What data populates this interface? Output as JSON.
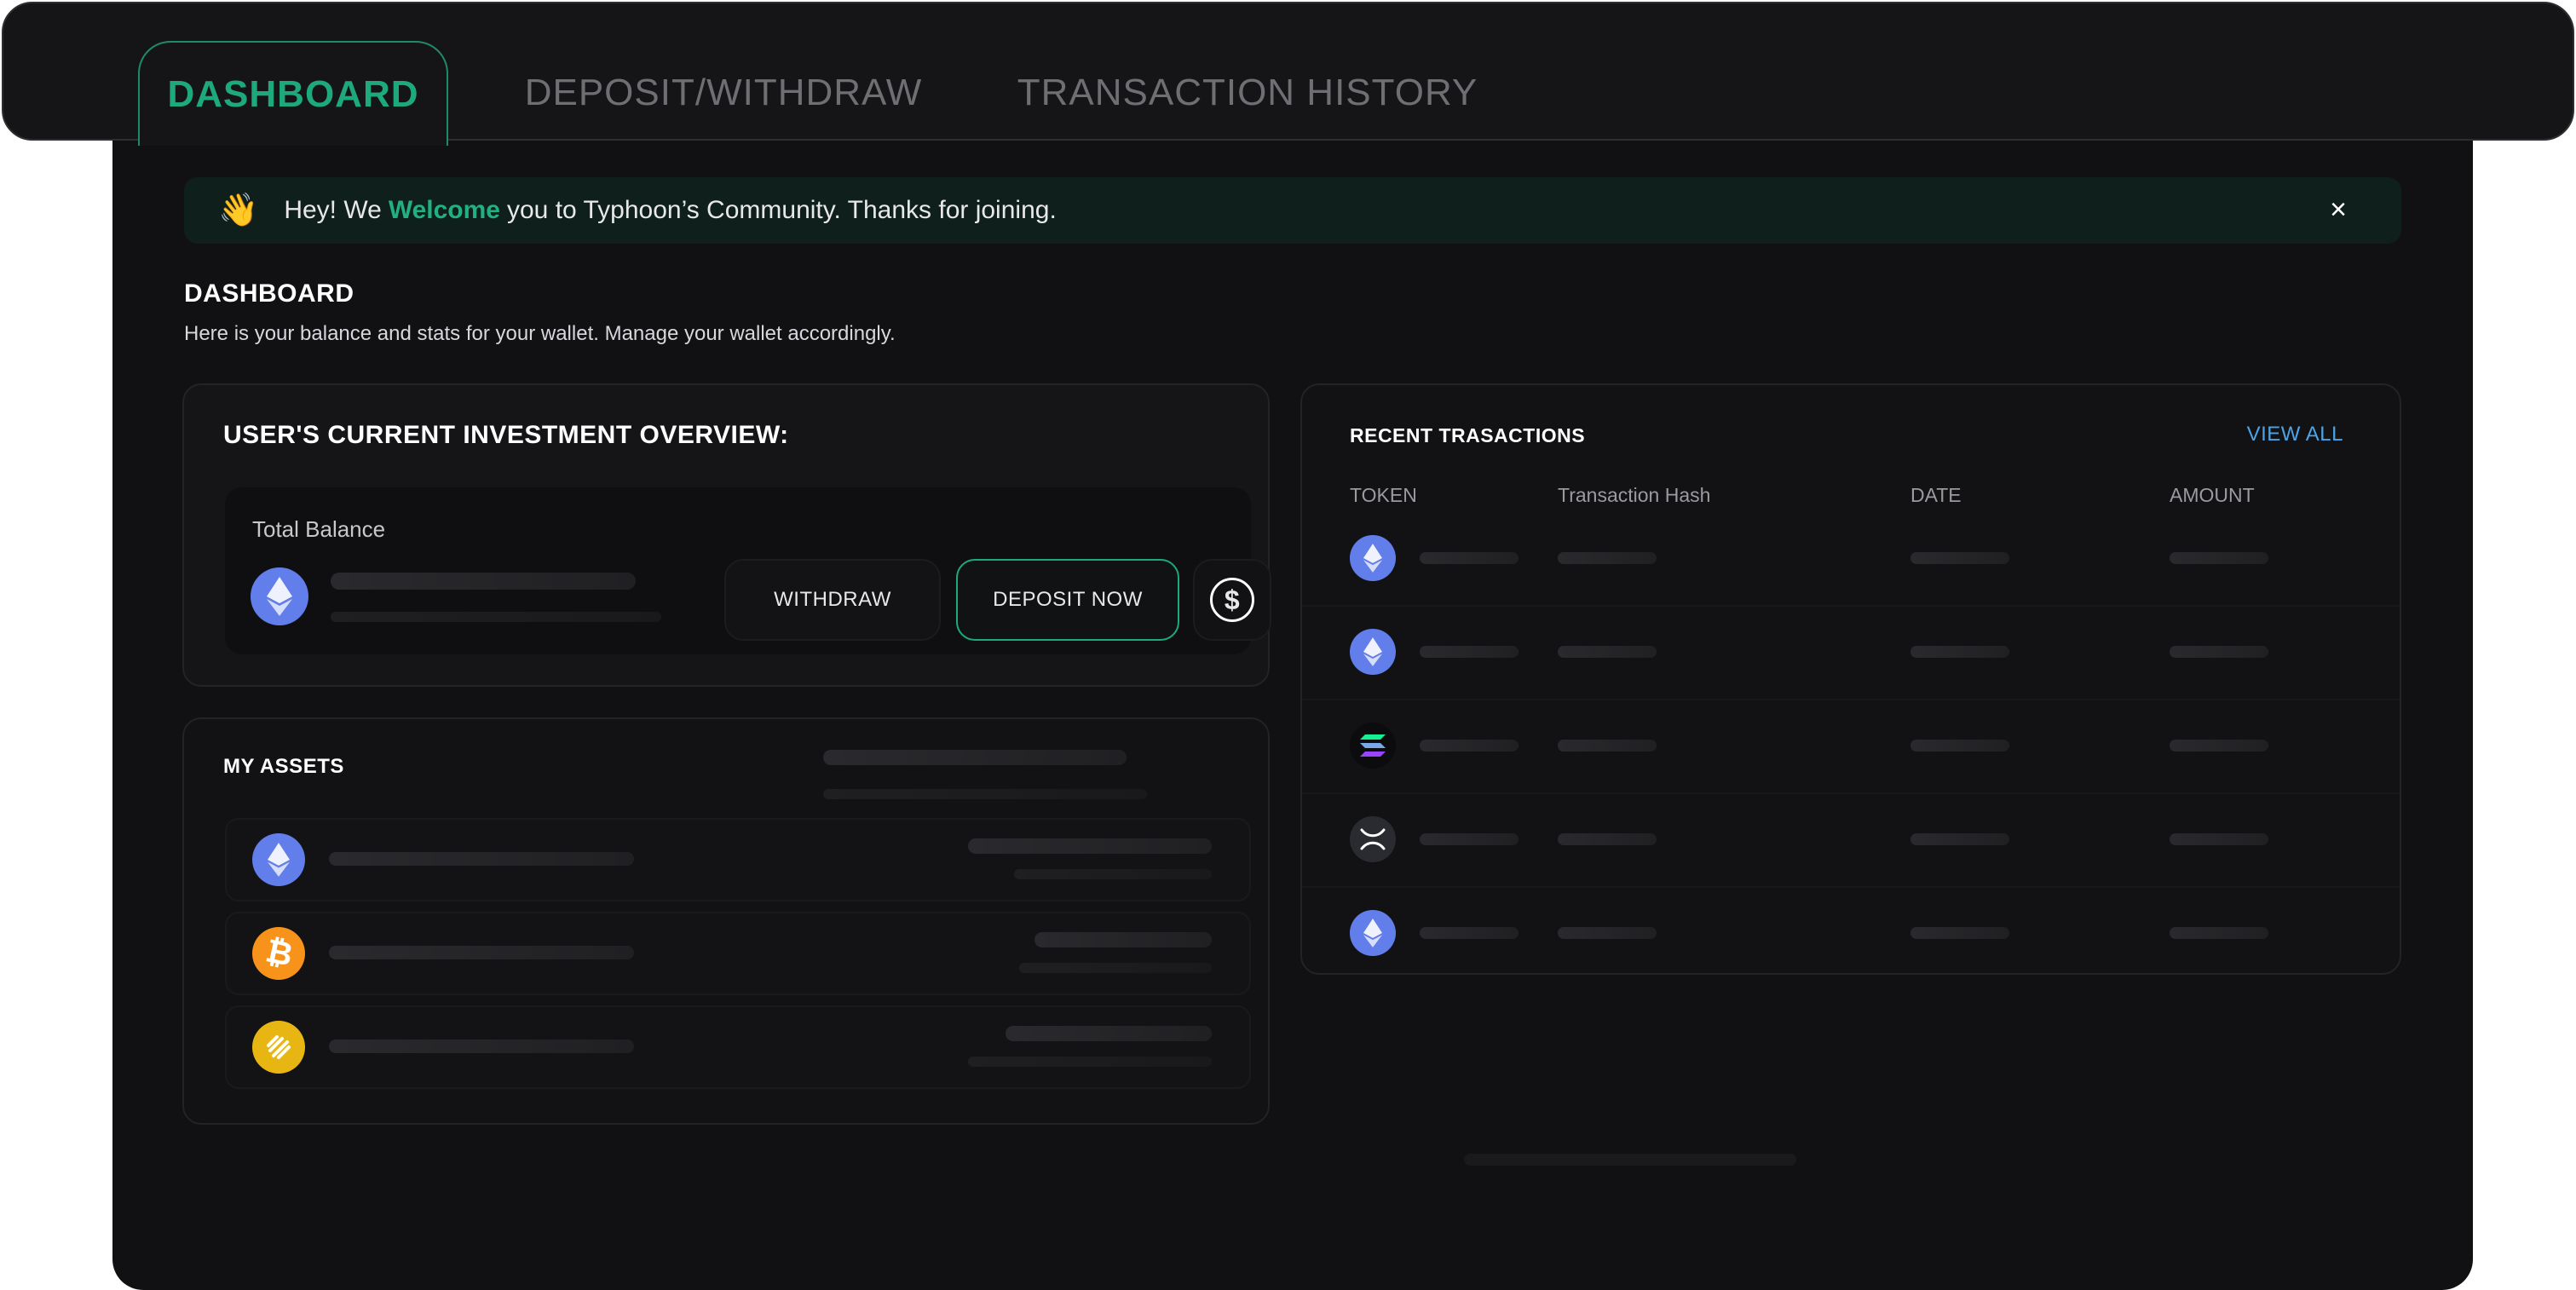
{
  "tabs": [
    {
      "label": "DASHBOARD",
      "active": true
    },
    {
      "label": "DEPOSIT/WITHDRAW",
      "active": false
    },
    {
      "label": "TRANSACTION HISTORY",
      "active": false
    }
  ],
  "banner": {
    "emoji": "👋",
    "prefix": "Hey! We",
    "highlight": "Welcome",
    "suffix": "you to Typhoon’s Community. Thanks for joining.",
    "close": "×",
    "highlight_color": "#21b07f"
  },
  "page": {
    "title": "DASHBOARD",
    "subtitle": "Here is your balance and stats for your wallet. Manage your wallet accordingly."
  },
  "overview": {
    "title": "USER'S CURRENT INVESTMENT OVERVIEW:",
    "balance_label": "Total Balance",
    "token_icon": "ethereum-icon",
    "withdraw_label": "WITHDRAW",
    "deposit_label": "DEPOSIT NOW",
    "deposit_border_color": "#1ea97c",
    "dollar_icon": "$"
  },
  "assets": {
    "title": "MY ASSETS",
    "items": [
      {
        "icon": "ethereum-icon",
        "color": "#627eea"
      },
      {
        "icon": "bitcoin-icon",
        "color": "#f7931a"
      },
      {
        "icon": "binance-usd-icon",
        "color": "#e8b613"
      }
    ]
  },
  "recent": {
    "title": "RECENT TRASACTIONS",
    "view_all": "VIEW ALL",
    "view_all_color": "#4ca3e6",
    "columns": [
      "TOKEN",
      "Transaction Hash",
      "DATE",
      "AMOUNT"
    ],
    "rows": [
      {
        "icon": "ethereum-icon"
      },
      {
        "icon": "ethereum-icon"
      },
      {
        "icon": "solana-icon"
      },
      {
        "icon": "xrp-icon"
      },
      {
        "icon": "ethereum-icon"
      }
    ]
  }
}
